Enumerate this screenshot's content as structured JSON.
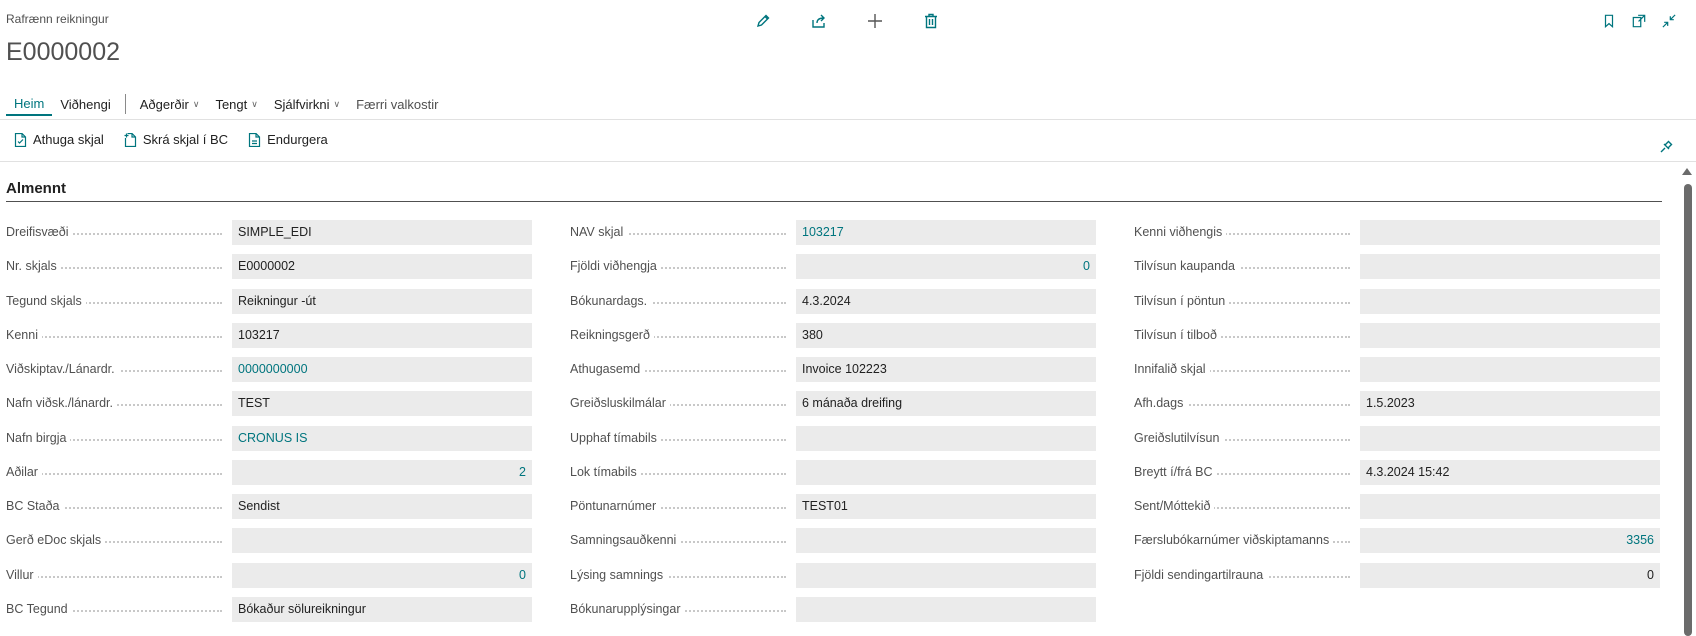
{
  "header": {
    "caption": "Rafrænn reikningur",
    "doc_no": "E0000002"
  },
  "top_actions": [
    "edit-icon",
    "share-icon",
    "add-icon",
    "delete-icon"
  ],
  "right_actions": [
    "bookmark-icon",
    "open-new-window-icon",
    "collapse-icon"
  ],
  "tabs": {
    "heim": "Heim",
    "vidhengi": "Viðhengi",
    "adgerdir": "Aðgerðir",
    "tengt": "Tengt",
    "sjalfvirkni": "Sjálfvirkni",
    "faerri": "Færri valkostir"
  },
  "actions": {
    "athuga": "Athuga skjal",
    "skra": "Skrá skjal í BC",
    "endurgera": "Endurgera"
  },
  "section": {
    "title": "Almennt"
  },
  "col1": [
    {
      "label": "Dreifisvæði",
      "value": "SIMPLE_EDI"
    },
    {
      "label": "Nr. skjals",
      "value": "E0000002"
    },
    {
      "label": "Tegund skjals",
      "value": "Reikningur -út"
    },
    {
      "label": "Kenni",
      "value": "103217"
    },
    {
      "label": "Viðskiptav./Lánardr.",
      "value": "0000000000"
    },
    {
      "label": "Nafn viðsk./lánardr.",
      "value": "TEST"
    },
    {
      "label": "Nafn birgja",
      "value": "CRONUS IS"
    },
    {
      "label": "Aðilar",
      "value": "2"
    },
    {
      "label": "BC Staða",
      "value": "Sendist"
    },
    {
      "label": "Gerð eDoc skjals",
      "value": ""
    },
    {
      "label": "Villur",
      "value": "0"
    },
    {
      "label": "BC Tegund",
      "value": "Bókaður sölureikningur"
    }
  ],
  "col2": [
    {
      "label": "NAV skjal",
      "value": "103217"
    },
    {
      "label": "Fjöldi viðhengja",
      "value": "0"
    },
    {
      "label": "Bókunardags.",
      "value": "4.3.2024"
    },
    {
      "label": "Reikningsgerð",
      "value": "380"
    },
    {
      "label": "Athugasemd",
      "value": "Invoice 102223"
    },
    {
      "label": "Greiðsluskilmálar",
      "value": "6 mánaða dreifing"
    },
    {
      "label": "Upphaf tímabils",
      "value": ""
    },
    {
      "label": "Lok tímabils",
      "value": ""
    },
    {
      "label": "Pöntunarnúmer",
      "value": "TEST01"
    },
    {
      "label": "Samningsauðkenni",
      "value": ""
    },
    {
      "label": "Lýsing samnings",
      "value": ""
    },
    {
      "label": "Bókunarupplýsingar",
      "value": ""
    }
  ],
  "col3": [
    {
      "label": "Kenni viðhengis",
      "value": ""
    },
    {
      "label": "Tilvísun kaupanda",
      "value": ""
    },
    {
      "label": "Tilvísun í pöntun",
      "value": ""
    },
    {
      "label": "Tilvísun í tilboð",
      "value": ""
    },
    {
      "label": "Innifalið skjal",
      "value": ""
    },
    {
      "label": "Afh.dags",
      "value": "1.5.2023"
    },
    {
      "label": "Greiðslutilvísun",
      "value": ""
    },
    {
      "label": "Breytt í/frá BC",
      "value": "4.3.2024 15:42"
    },
    {
      "label": "Sent/Móttekið",
      "value": ""
    },
    {
      "label": "Færslubókarnúmer viðskiptamanns",
      "value": "3356"
    },
    {
      "label": "Fjöldi sendingartilrauna",
      "value": "0"
    }
  ]
}
